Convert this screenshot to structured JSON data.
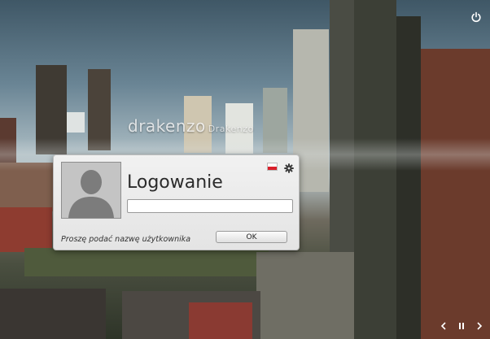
{
  "screen": {
    "hostname": "drakenzo",
    "hostname_sub": "Drakenzo",
    "power_icon": "power-icon"
  },
  "login_dialog": {
    "title": "Logowanie",
    "username_value": "",
    "username_placeholder": "",
    "prompt": "Proszę podać nazwę użytkownika",
    "ok_label": "OK",
    "language_icon": "flag-pl-icon",
    "settings_icon": "gear-icon"
  },
  "slideshow_controls": {
    "prev_icon": "chevron-left-icon",
    "pause_icon": "pause-icon",
    "next_icon": "chevron-right-icon"
  },
  "colors": {
    "dialog_bg": "#eaeaea",
    "flag_red": "#d9202b",
    "text_dark": "#2b2b2b"
  }
}
